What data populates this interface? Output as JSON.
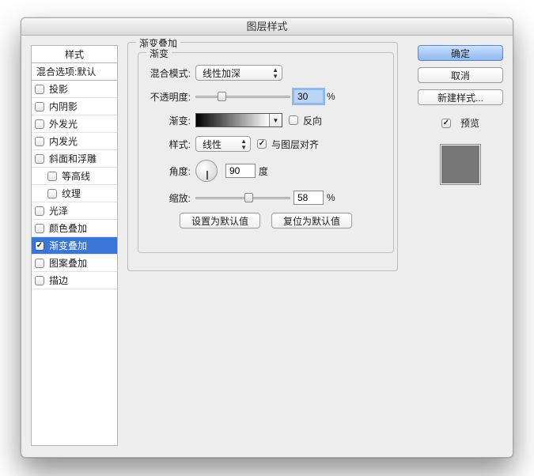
{
  "window": {
    "title": "图层样式"
  },
  "styles_panel": {
    "header": "样式",
    "subheader": "混合选项:默认",
    "items": [
      {
        "label": "投影",
        "checked": false,
        "selected": false
      },
      {
        "label": "内阴影",
        "checked": false,
        "selected": false
      },
      {
        "label": "外发光",
        "checked": false,
        "selected": false
      },
      {
        "label": "内发光",
        "checked": false,
        "selected": false
      },
      {
        "label": "斜面和浮雕",
        "checked": false,
        "selected": false
      },
      {
        "label": "等高线",
        "checked": false,
        "selected": false,
        "indent": true
      },
      {
        "label": "纹理",
        "checked": false,
        "selected": false,
        "indent": true
      },
      {
        "label": "光泽",
        "checked": false,
        "selected": false
      },
      {
        "label": "颜色叠加",
        "checked": false,
        "selected": false
      },
      {
        "label": "渐变叠加",
        "checked": true,
        "selected": true
      },
      {
        "label": "图案叠加",
        "checked": false,
        "selected": false
      },
      {
        "label": "描边",
        "checked": false,
        "selected": false
      }
    ]
  },
  "group": {
    "title": "渐变叠加",
    "subtitle": "渐变"
  },
  "form": {
    "blend_mode_label": "混合模式:",
    "blend_mode_value": "线性加深",
    "opacity_label": "不透明度:",
    "opacity_value": "30",
    "percent": "%",
    "gradient_label": "渐变:",
    "reverse_label": "反向",
    "reverse_checked": false,
    "style_label": "样式:",
    "style_value": "线性",
    "align_label": "与图层对齐",
    "align_checked": true,
    "angle_label": "角度:",
    "angle_value": "90",
    "degree": "度",
    "scale_label": "缩放:",
    "scale_value": "58",
    "set_default": "设置为默认值",
    "reset_default": "复位为默认值"
  },
  "right": {
    "ok": "确定",
    "cancel": "取消",
    "new_style": "新建样式...",
    "preview_label": "预览",
    "preview_checked": true
  }
}
